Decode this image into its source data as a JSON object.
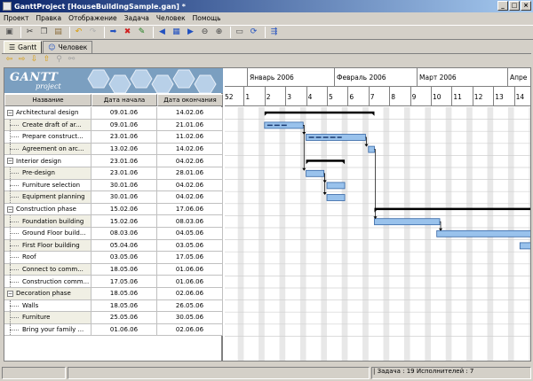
{
  "window": {
    "title": "GanttProject [HouseBuildingSample.gan] *",
    "minimize": "_",
    "maximize": "□",
    "close": "×"
  },
  "menu": [
    "Проект",
    "Правка",
    "Отображение",
    "Задача",
    "Человек",
    "Помощь"
  ],
  "toolbar_icons": [
    "save-icon",
    "cut-icon",
    "copy-icon",
    "paste-icon",
    "undo-icon",
    "redo-icon",
    "indent-icon",
    "delete-icon",
    "properties-icon",
    "scroll-left-icon",
    "zoom-prev-icon",
    "scroll-right-icon",
    "zoom-out-icon",
    "zoom-in-icon",
    "print-preview-icon",
    "refresh-icon",
    "critical-path-icon"
  ],
  "tabs": [
    {
      "label": "Gantt",
      "active": true
    },
    {
      "label": "Человек",
      "active": false
    }
  ],
  "logo": {
    "brand": "GANTT",
    "sub": "project"
  },
  "table": {
    "headers": {
      "name": "Название",
      "start": "Дата начала",
      "end": "Дата окончания"
    },
    "rows": [
      {
        "name": "Architectural design",
        "start": "09.01.06",
        "end": "14.02.06",
        "group": true
      },
      {
        "name": "Create draft of ar...",
        "start": "09.01.06",
        "end": "21.01.06",
        "group": false
      },
      {
        "name": "Prepare construct...",
        "start": "23.01.06",
        "end": "11.02.06",
        "group": false
      },
      {
        "name": "Agreement on arc...",
        "start": "13.02.06",
        "end": "14.02.06",
        "group": false
      },
      {
        "name": "Interior design",
        "start": "23.01.06",
        "end": "04.02.06",
        "group": true
      },
      {
        "name": "Pre-design",
        "start": "23.01.06",
        "end": "28.01.06",
        "group": false
      },
      {
        "name": "Furniture selection",
        "start": "30.01.06",
        "end": "04.02.06",
        "group": false
      },
      {
        "name": "Equipment planning",
        "start": "30.01.06",
        "end": "04.02.06",
        "group": false
      },
      {
        "name": "Construction phase",
        "start": "15.02.06",
        "end": "17.06.06",
        "group": true
      },
      {
        "name": "Foundation building",
        "start": "15.02.06",
        "end": "08.03.06",
        "group": false
      },
      {
        "name": "Ground Floor build...",
        "start": "08.03.06",
        "end": "04.05.06",
        "group": false
      },
      {
        "name": "First Floor building",
        "start": "05.04.06",
        "end": "03.05.06",
        "group": false
      },
      {
        "name": "Roof",
        "start": "03.05.06",
        "end": "17.05.06",
        "group": false
      },
      {
        "name": "Connect to comm...",
        "start": "18.05.06",
        "end": "01.06.06",
        "group": false
      },
      {
        "name": "Construction comm...",
        "start": "17.05.06",
        "end": "01.06.06",
        "group": false
      },
      {
        "name": "Decoration phase",
        "start": "18.05.06",
        "end": "02.06.06",
        "group": true
      },
      {
        "name": "Walls",
        "start": "18.05.06",
        "end": "26.05.06",
        "group": false
      },
      {
        "name": "Furniture",
        "start": "25.05.06",
        "end": "30.05.06",
        "group": false
      },
      {
        "name": "Bring your family ...",
        "start": "01.06.06",
        "end": "02.06.06",
        "group": false
      }
    ]
  },
  "timeline": {
    "months": [
      "Январь 2006",
      "Февраль 2006",
      "Март 2006",
      "Апре"
    ],
    "weeks": [
      "52",
      "1",
      "2",
      "3",
      "4",
      "5",
      "6",
      "7",
      "8",
      "9",
      "10",
      "11",
      "12",
      "13",
      "14"
    ]
  },
  "status": {
    "text": "| Задача : 19  Исполнителей : 7"
  },
  "colors": {
    "task_bar": "#99c2ec",
    "task_border": "#3465a4",
    "summary": "#000000",
    "weekend": "#e8e8e8",
    "title_start": "#0a246a",
    "title_end": "#a6caf0"
  }
}
